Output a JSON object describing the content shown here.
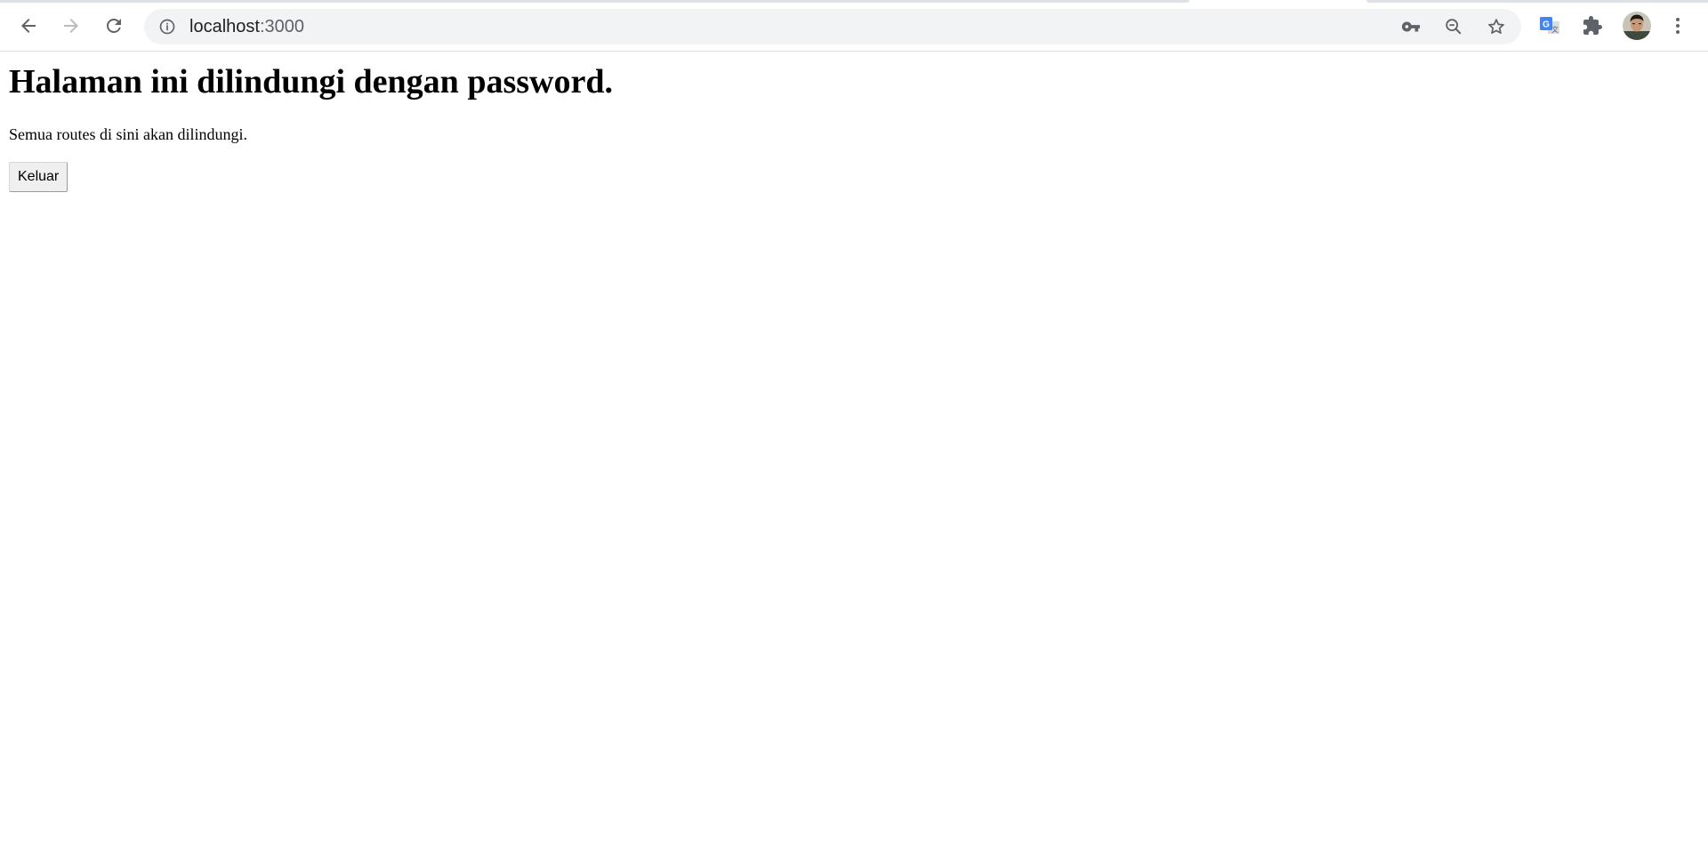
{
  "browser": {
    "url_host": "localhost",
    "url_port": ":3000",
    "icons": {
      "back": "arrow-left",
      "forward": "arrow-right",
      "reload": "reload",
      "site_info": "info-circle",
      "password_key": "key",
      "zoom": "zoom-out",
      "bookmark": "star-outline",
      "translate": "google-translate",
      "extensions": "puzzle-piece",
      "profile": "avatar",
      "menu": "three-dots-vertical"
    }
  },
  "page": {
    "heading": "Halaman ini dilindungi dengan password.",
    "description": "Semua routes di sini akan dilindungi.",
    "logout_label": "Keluar"
  }
}
